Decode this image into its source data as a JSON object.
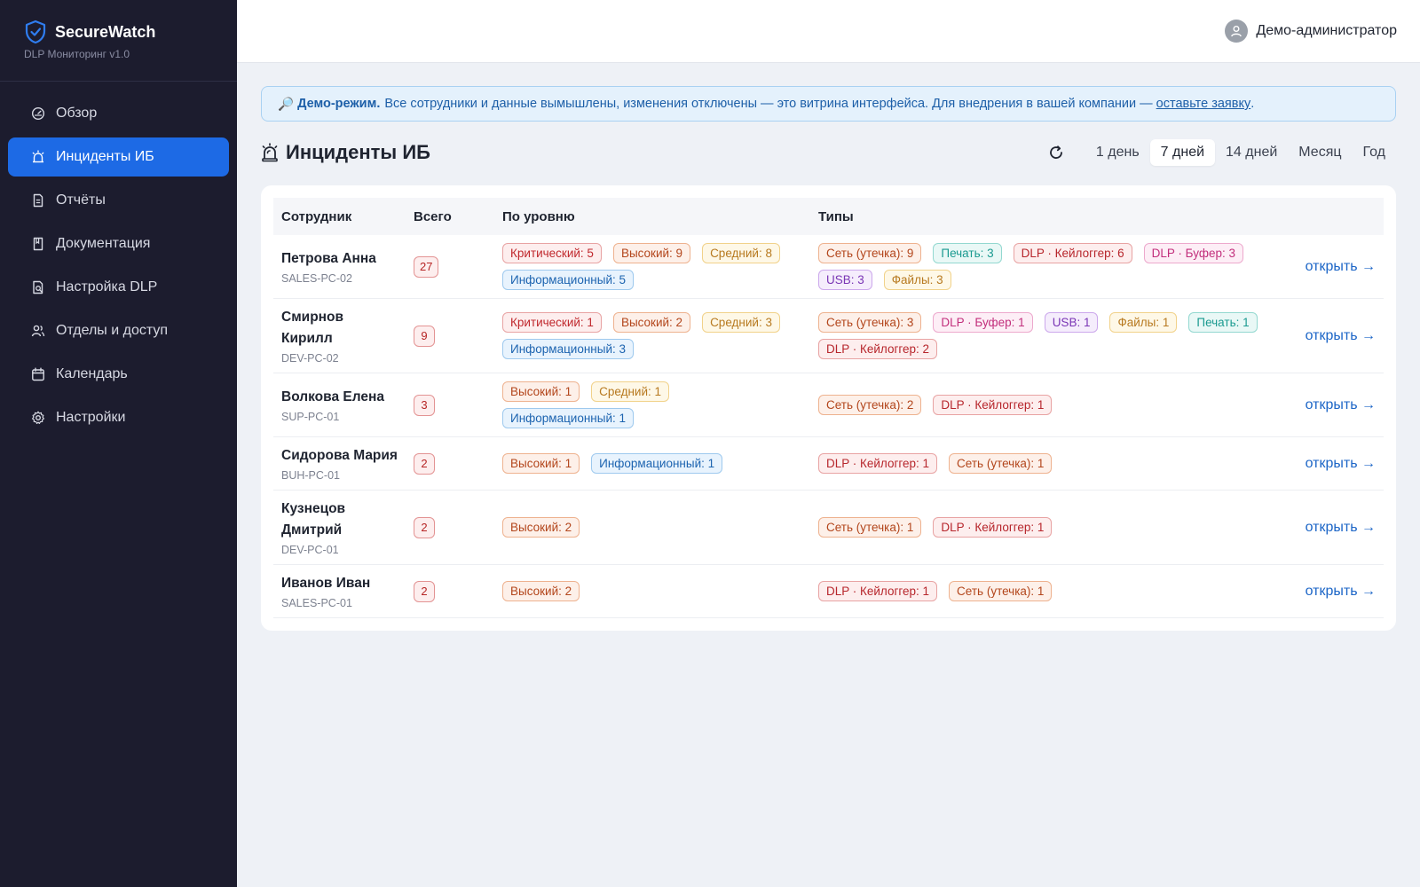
{
  "brand": {
    "name": "SecureWatch",
    "subtitle": "DLP Мониторинг v1.0"
  },
  "sidebar": {
    "items": [
      {
        "label": "Обзор",
        "icon": "dashboard-icon",
        "active": false
      },
      {
        "label": "Инциденты ИБ",
        "icon": "alarm-icon",
        "active": true
      },
      {
        "label": "Отчёты",
        "icon": "report-icon",
        "active": false
      },
      {
        "label": "Документация",
        "icon": "book-icon",
        "active": false
      },
      {
        "label": "Настройка DLP",
        "icon": "dlp-settings-icon",
        "active": false
      },
      {
        "label": "Отделы и доступ",
        "icon": "users-icon",
        "active": false
      },
      {
        "label": "Календарь",
        "icon": "calendar-icon",
        "active": false
      },
      {
        "label": "Настройки",
        "icon": "gear-icon",
        "active": false
      }
    ]
  },
  "topbar": {
    "user_name": "Демо-администратор"
  },
  "banner": {
    "icon": "🔎",
    "bold": "Демо-режим.",
    "text": "Все сотрудники и данные вымышлены, изменения отключены — это витрина интерфейса. Для внедрения в вашей компании —",
    "link": "оставьте заявку",
    "suffix": "."
  },
  "page": {
    "title": "Инциденты ИБ"
  },
  "periods": [
    {
      "label": "1 день",
      "active": false
    },
    {
      "label": "7 дней",
      "active": true
    },
    {
      "label": "14 дней",
      "active": false
    },
    {
      "label": "Месяц",
      "active": false
    },
    {
      "label": "Год",
      "active": false
    }
  ],
  "table": {
    "headers": {
      "employee": "Сотрудник",
      "total": "Всего",
      "levels": "По уровню",
      "types": "Типы"
    },
    "open_label": "открыть →",
    "rows": [
      {
        "name": "Петрова Анна",
        "host": "SALES-PC-02",
        "total": "27",
        "levels": [
          {
            "text": "Критический: 5",
            "kind": "critical"
          },
          {
            "text": "Высокий: 9",
            "kind": "high"
          },
          {
            "text": "Средний: 8",
            "kind": "medium"
          },
          {
            "text": "Информационный: 5",
            "kind": "info"
          }
        ],
        "types": [
          {
            "text": "Сеть (утечка): 9",
            "kind": "network"
          },
          {
            "text": "Печать: 3",
            "kind": "print"
          },
          {
            "text": "DLP · Кейлоггер: 6",
            "kind": "keylogger"
          },
          {
            "text": "DLP · Буфер: 3",
            "kind": "buffer"
          },
          {
            "text": "USB: 3",
            "kind": "usb"
          },
          {
            "text": "Файлы: 3",
            "kind": "files"
          }
        ]
      },
      {
        "name": "Смирнов Кирилл",
        "host": "DEV-PC-02",
        "total": "9",
        "levels": [
          {
            "text": "Критический: 1",
            "kind": "critical"
          },
          {
            "text": "Высокий: 2",
            "kind": "high"
          },
          {
            "text": "Средний: 3",
            "kind": "medium"
          },
          {
            "text": "Информационный: 3",
            "kind": "info"
          }
        ],
        "types": [
          {
            "text": "Сеть (утечка): 3",
            "kind": "network"
          },
          {
            "text": "DLP · Буфер: 1",
            "kind": "buffer"
          },
          {
            "text": "USB: 1",
            "kind": "usb"
          },
          {
            "text": "Файлы: 1",
            "kind": "files"
          },
          {
            "text": "Печать: 1",
            "kind": "print"
          },
          {
            "text": "DLP · Кейлоггер: 2",
            "kind": "keylogger"
          }
        ]
      },
      {
        "name": "Волкова Елена",
        "host": "SUP-PC-01",
        "total": "3",
        "levels": [
          {
            "text": "Высокий: 1",
            "kind": "high"
          },
          {
            "text": "Средний: 1",
            "kind": "medium"
          },
          {
            "text": "Информационный: 1",
            "kind": "info"
          }
        ],
        "types": [
          {
            "text": "Сеть (утечка): 2",
            "kind": "network"
          },
          {
            "text": "DLP · Кейлоггер: 1",
            "kind": "keylogger"
          }
        ]
      },
      {
        "name": "Сидорова Мария",
        "host": "BUH-PC-01",
        "total": "2",
        "levels": [
          {
            "text": "Высокий: 1",
            "kind": "high"
          },
          {
            "text": "Информационный: 1",
            "kind": "info"
          }
        ],
        "types": [
          {
            "text": "DLP · Кейлоггер: 1",
            "kind": "keylogger"
          },
          {
            "text": "Сеть (утечка): 1",
            "kind": "network"
          }
        ]
      },
      {
        "name": "Кузнецов Дмитрий",
        "host": "DEV-PC-01",
        "total": "2",
        "levels": [
          {
            "text": "Высокий: 2",
            "kind": "high"
          }
        ],
        "types": [
          {
            "text": "Сеть (утечка): 1",
            "kind": "network"
          },
          {
            "text": "DLP · Кейлоггер: 1",
            "kind": "keylogger"
          }
        ]
      },
      {
        "name": "Иванов Иван",
        "host": "SALES-PC-01",
        "total": "2",
        "levels": [
          {
            "text": "Высокий: 2",
            "kind": "high"
          }
        ],
        "types": [
          {
            "text": "DLP · Кейлоггер: 1",
            "kind": "keylogger"
          },
          {
            "text": "Сеть (утечка): 1",
            "kind": "network"
          }
        ]
      }
    ]
  },
  "chip_colors": {
    "critical": {
      "fg": "#c0282d",
      "bg": "#fdeeee",
      "border": "#e8a3a3"
    },
    "high": {
      "fg": "#b3461c",
      "bg": "#fdf0e9",
      "border": "#eeb28f"
    },
    "medium": {
      "fg": "#b7791f",
      "bg": "#fef8e7",
      "border": "#f1d28a"
    },
    "info": {
      "fg": "#1d64b0",
      "bg": "#e8f3fd",
      "border": "#9ec9ee"
    },
    "network": {
      "fg": "#b3461c",
      "bg": "#fdf0e9",
      "border": "#eeb28f"
    },
    "print": {
      "fg": "#1a9a90",
      "bg": "#e9f8f6",
      "border": "#93d8d0"
    },
    "keylogger": {
      "fg": "#b7262c",
      "bg": "#fdeeee",
      "border": "#e8a3a3"
    },
    "buffer": {
      "fg": "#c22f7c",
      "bg": "#fdeef6",
      "border": "#eda9cd"
    },
    "usb": {
      "fg": "#7a35b5",
      "bg": "#f5edfc",
      "border": "#cca8ec"
    },
    "files": {
      "fg": "#b7791f",
      "bg": "#fef8e7",
      "border": "#f1d28a"
    }
  }
}
